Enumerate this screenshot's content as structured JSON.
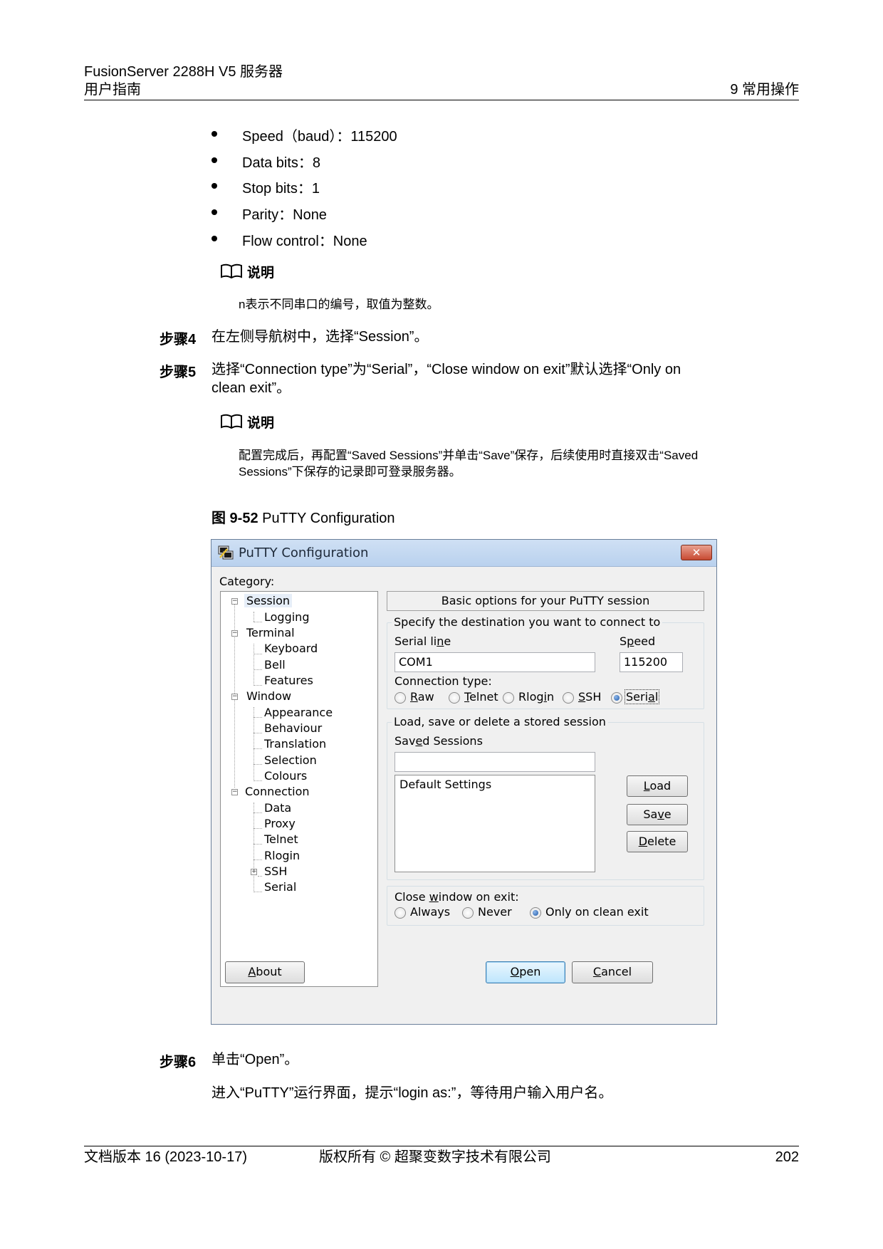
{
  "header": {
    "product": "FusionServer 2288H V5 服务器",
    "doc_title": "用户指南",
    "chapter": "9 常用操作"
  },
  "bullets": [
    "Speed（baud）：115200",
    "Data bits：8",
    "Stop bits：1",
    "Parity：None",
    "Flow control：None"
  ],
  "notes": [
    {
      "label": "说明",
      "text": "n表示不同串口的编号，取值为整数。"
    },
    {
      "label": "说明",
      "text_line1": "配置完成后，再配置“Saved Sessions”并单击“Save”保存，后续使用时直接双击“Saved",
      "text_line2": "Sessions”下保存的记录即可登录服务器。"
    }
  ],
  "steps": {
    "step4": {
      "label": "步骤4",
      "text": "在左侧导航树中，选择“Session”。"
    },
    "step5": {
      "label": "步骤5",
      "text_line1": "选择“Connection type”为“Serial”，“Close window on exit”默认选择“Only on",
      "text_line2": "clean exit”。"
    },
    "step6": {
      "label": "步骤6",
      "text": "单击“Open”。",
      "followup": "进入“PuTTY”运行界面，提示“login as:”，等待用户输入用户名。"
    }
  },
  "figure": {
    "number": "图 9-52",
    "caption": "PuTTY Configuration"
  },
  "putty": {
    "title": "PuTTY Configuration",
    "category_label": "Category:",
    "tree": [
      {
        "label": "Session",
        "selected": true
      },
      {
        "label": "Logging"
      },
      {
        "label": "Terminal"
      },
      {
        "label": "Keyboard"
      },
      {
        "label": "Bell"
      },
      {
        "label": "Features"
      },
      {
        "label": "Window"
      },
      {
        "label": "Appearance"
      },
      {
        "label": "Behaviour"
      },
      {
        "label": "Translation"
      },
      {
        "label": "Selection"
      },
      {
        "label": "Colours"
      },
      {
        "label": "Connection"
      },
      {
        "label": "Data"
      },
      {
        "label": "Proxy"
      },
      {
        "label": "Telnet"
      },
      {
        "label": "Rlogin"
      },
      {
        "label": "SSH"
      },
      {
        "label": "Serial"
      }
    ],
    "banner": "Basic options for your PuTTY session",
    "destination_group": "Specify the destination you want to connect to",
    "serial_line_label": "Serial line",
    "serial_line_value": "COM1",
    "speed_label": "Speed",
    "speed_value": "115200",
    "connection_type_label": "Connection type:",
    "connection_types": [
      "Raw",
      "Telnet",
      "Rlogin",
      "SSH",
      "Serial"
    ],
    "connection_type_selected": "Serial",
    "sessions_group": "Load, save or delete a stored session",
    "saved_sessions_label": "Saved Sessions",
    "saved_sessions_value": "",
    "sessions_list": [
      "Default Settings"
    ],
    "load_button": "Load",
    "save_button": "Save",
    "delete_button": "Delete",
    "close_window_label": "Close window on exit:",
    "close_options": [
      "Always",
      "Never",
      "Only on clean exit"
    ],
    "close_selected": "Only on clean exit",
    "about_button": "About",
    "open_button": "Open",
    "cancel_button": "Cancel",
    "close_glyph": "✕"
  },
  "footer": {
    "version": "文档版本 16 (2023-10-17)",
    "copyright": "版权所有 © 超聚变数字技术有限公司",
    "page": "202"
  }
}
